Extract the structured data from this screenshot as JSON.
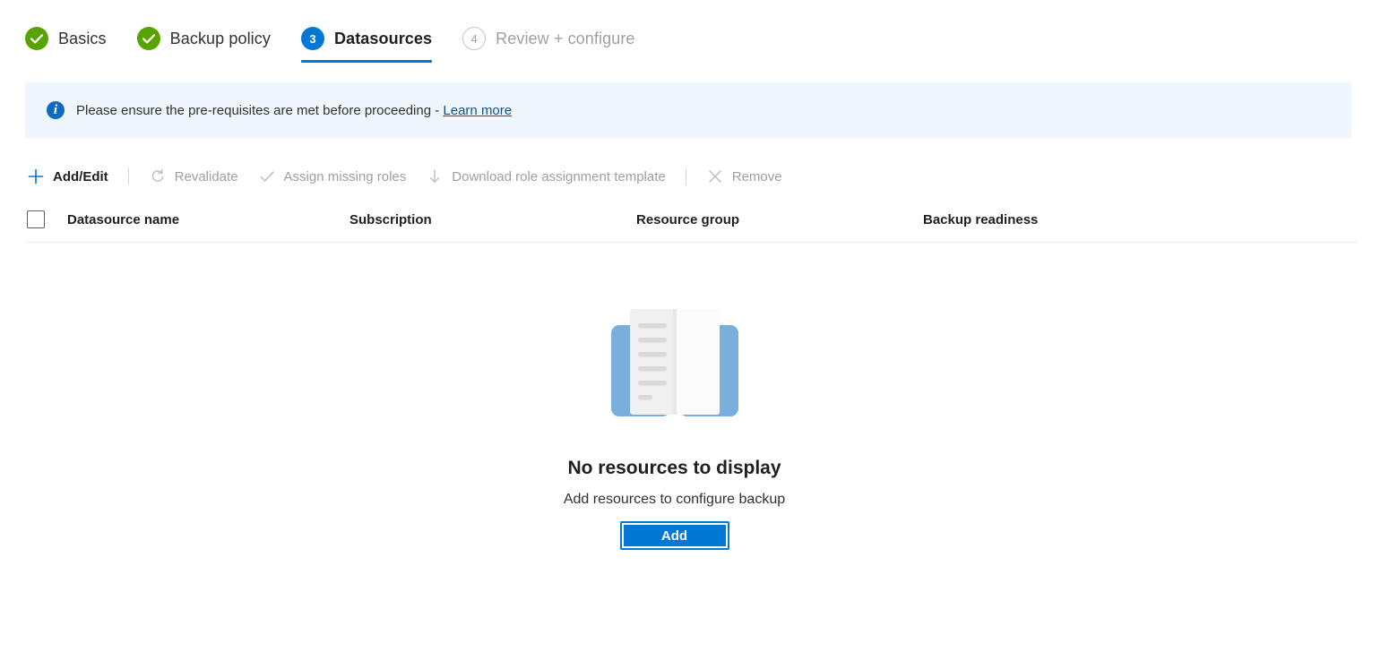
{
  "wizard": {
    "steps": [
      {
        "label": "Basics",
        "state": "done",
        "marker": "check"
      },
      {
        "label": "Backup policy",
        "state": "done",
        "marker": "check"
      },
      {
        "label": "Datasources",
        "state": "current",
        "marker": "3"
      },
      {
        "label": "Review + configure",
        "state": "upcoming",
        "marker": "4"
      }
    ]
  },
  "info_banner": {
    "icon": "info-icon",
    "text": "Please ensure the pre-requisites are met before proceeding - ",
    "link_text": "Learn more"
  },
  "command_bar": {
    "items": [
      {
        "label": "Add/Edit",
        "icon": "plus-icon",
        "enabled": true
      },
      {
        "label": "Revalidate",
        "icon": "refresh-icon",
        "enabled": false
      },
      {
        "label": "Assign missing roles",
        "icon": "checkmark-icon",
        "enabled": false
      },
      {
        "label": "Download role assignment template",
        "icon": "download-arrow-icon",
        "enabled": false
      },
      {
        "label": "Remove",
        "icon": "close-x-icon",
        "enabled": false
      }
    ]
  },
  "table": {
    "select_all_checked": false,
    "columns": [
      "Datasource name",
      "Subscription",
      "Resource group",
      "Backup readiness"
    ],
    "rows": []
  },
  "empty_state": {
    "illustration": "open-book-icon",
    "title": "No resources to display",
    "subtitle": "Add resources to configure backup",
    "button_label": "Add"
  },
  "colors": {
    "accent": "#0078d4",
    "success": "#57a300",
    "banner_bg": "#eff6fc",
    "link": "#0f548c",
    "disabled_text": "#a19f9d"
  }
}
